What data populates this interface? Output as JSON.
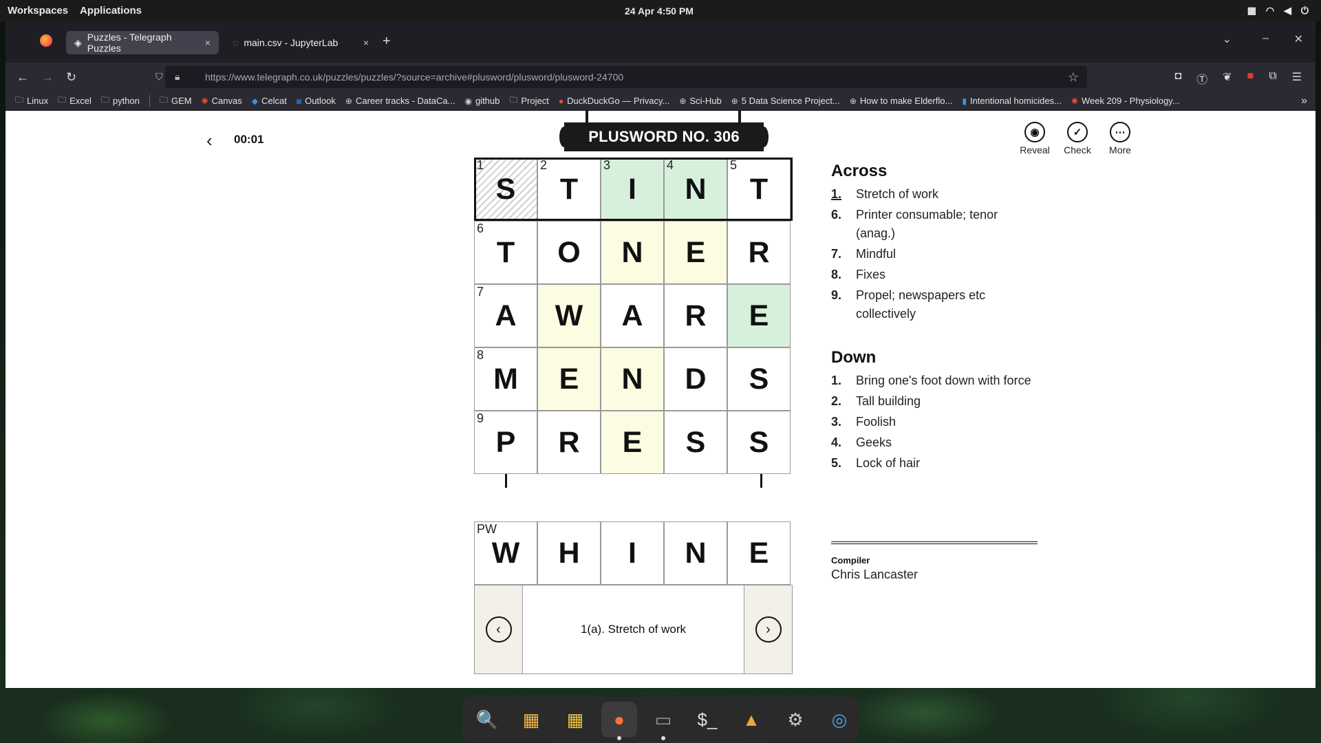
{
  "system_bar": {
    "workspaces": "Workspaces",
    "applications": "Applications",
    "clock": "24 Apr  4:50 PM"
  },
  "tabs": [
    {
      "label": "Puzzles - Telegraph Puzzles",
      "close": "×"
    },
    {
      "label": "main.csv - JupyterLab",
      "close": "×"
    }
  ],
  "new_tab": "+",
  "address_bar": {
    "url": "https://www.telegraph.co.uk/puzzles/puzzles/?source=archive#plusword/plusword/plusword-24700"
  },
  "bookmarks": [
    {
      "label": "Linux",
      "icon": "folder-icon"
    },
    {
      "label": "Excel",
      "icon": "folder-icon"
    },
    {
      "label": "python",
      "icon": "folder-icon"
    },
    {
      "label": "GEM",
      "icon": "folder-icon"
    },
    {
      "label": "Canvas",
      "icon": "canvas-icon"
    },
    {
      "label": "Celcat",
      "icon": "celcat-icon"
    },
    {
      "label": "Outlook",
      "icon": "outlook-icon"
    },
    {
      "label": "Career tracks - DataCa...",
      "icon": "globe-icon"
    },
    {
      "label": "github",
      "icon": "github-icon"
    },
    {
      "label": "Project",
      "icon": "folder-icon"
    },
    {
      "label": "DuckDuckGo — Privacy...",
      "icon": "duckduckgo-icon"
    },
    {
      "label": "Sci-Hub",
      "icon": "globe-icon"
    },
    {
      "label": "5 Data Science Project...",
      "icon": "globe-icon"
    },
    {
      "label": "How to make Elderflo...",
      "icon": "globe-icon"
    },
    {
      "label": "Intentional homicides...",
      "icon": "chart-icon"
    },
    {
      "label": "Week 209 - Physiology...",
      "icon": "red-site-icon"
    }
  ],
  "puzzle": {
    "timer": "00:01",
    "title": "PLUSWORD NO. 306",
    "tools": [
      {
        "label": "Reveal",
        "icon": "eye-icon",
        "glyph": "◉"
      },
      {
        "label": "Check",
        "icon": "check-icon",
        "glyph": "✓"
      },
      {
        "label": "More",
        "icon": "more-icon",
        "glyph": "⋯"
      }
    ],
    "grid": [
      [
        {
          "l": "S",
          "n": "1",
          "s": "hatch"
        },
        {
          "l": "T",
          "n": "2",
          "s": ""
        },
        {
          "l": "I",
          "n": "3",
          "s": "hl"
        },
        {
          "l": "N",
          "n": "4",
          "s": "hl"
        },
        {
          "l": "T",
          "n": "5",
          "s": ""
        }
      ],
      [
        {
          "l": "T",
          "n": "6",
          "s": ""
        },
        {
          "l": "O",
          "n": "",
          "s": ""
        },
        {
          "l": "N",
          "n": "",
          "s": "yl"
        },
        {
          "l": "E",
          "n": "",
          "s": "yl"
        },
        {
          "l": "R",
          "n": "",
          "s": ""
        }
      ],
      [
        {
          "l": "A",
          "n": "7",
          "s": ""
        },
        {
          "l": "W",
          "n": "",
          "s": "yl"
        },
        {
          "l": "A",
          "n": "",
          "s": ""
        },
        {
          "l": "R",
          "n": "",
          "s": ""
        },
        {
          "l": "E",
          "n": "",
          "s": "hl"
        }
      ],
      [
        {
          "l": "M",
          "n": "8",
          "s": ""
        },
        {
          "l": "E",
          "n": "",
          "s": "yl"
        },
        {
          "l": "N",
          "n": "",
          "s": "yl"
        },
        {
          "l": "D",
          "n": "",
          "s": ""
        },
        {
          "l": "S",
          "n": "",
          "s": ""
        }
      ],
      [
        {
          "l": "P",
          "n": "9",
          "s": ""
        },
        {
          "l": "R",
          "n": "",
          "s": ""
        },
        {
          "l": "E",
          "n": "",
          "s": "yl"
        },
        {
          "l": "S",
          "n": "",
          "s": ""
        },
        {
          "l": "S",
          "n": "",
          "s": ""
        }
      ]
    ],
    "plusword_row": {
      "label": "PW",
      "letters": [
        "W",
        "H",
        "I",
        "N",
        "E"
      ]
    },
    "current_clue": "1(a). Stretch of work",
    "across_title": "Across",
    "across": [
      {
        "n": "1.",
        "text": "Stretch of work"
      },
      {
        "n": "6.",
        "text": "Printer consumable; tenor (anag.)"
      },
      {
        "n": "7.",
        "text": "Mindful"
      },
      {
        "n": "8.",
        "text": "Fixes"
      },
      {
        "n": "9.",
        "text": "Propel; newspapers etc collectively"
      }
    ],
    "down_title": "Down",
    "down": [
      {
        "n": "1.",
        "text": "Bring one's foot down with force"
      },
      {
        "n": "2.",
        "text": "Tall building"
      },
      {
        "n": "3.",
        "text": "Foolish"
      },
      {
        "n": "4.",
        "text": "Geeks"
      },
      {
        "n": "5.",
        "text": "Lock of hair"
      }
    ],
    "compiler_label": "Compiler",
    "compiler": "Chris Lancaster"
  },
  "colors": {
    "highlight_green": "#d7f0db",
    "highlight_yellow": "#fcfce2"
  },
  "dock": [
    {
      "name": "search-app-icon",
      "glyph": "🔍",
      "color": "#3fa7d6"
    },
    {
      "name": "gallery-app-icon",
      "glyph": "▦",
      "color": "#f2b544"
    },
    {
      "name": "app-grid-icon",
      "glyph": "▦",
      "color": "#f0c23b"
    },
    {
      "name": "firefox-app-icon",
      "glyph": "●",
      "color": "#ff7139",
      "active": true
    },
    {
      "name": "files-app-icon",
      "glyph": "▭",
      "color": "#9aa0a6",
      "running": true
    },
    {
      "name": "terminal-app-icon",
      "glyph": "$_",
      "color": "#ddd"
    },
    {
      "name": "launcher-app-icon",
      "glyph": "▲",
      "color": "#f4a340"
    },
    {
      "name": "settings-app-icon",
      "glyph": "⚙",
      "color": "#ccc"
    },
    {
      "name": "steam-app-icon",
      "glyph": "◎",
      "color": "#4aa3df"
    }
  ]
}
